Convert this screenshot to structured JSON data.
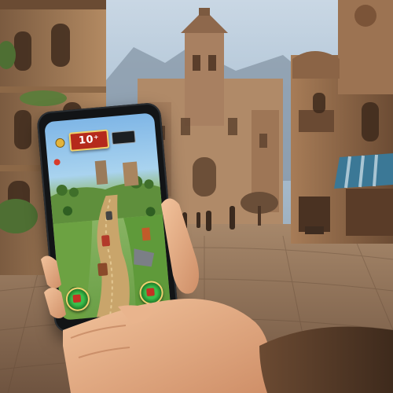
{
  "scene": {
    "description_kind": "photo-illustration",
    "colors": {
      "sky": "#b9cfe0",
      "stone": "#a07a58",
      "ground": "#8b6d52",
      "awning": "#3d7b97",
      "skin": "#e7b089"
    }
  },
  "game": {
    "score_label": "10⁺",
    "icons": {
      "coin": "coin-icon",
      "left_control": "green-round-button",
      "right_control": "green-round-button"
    }
  }
}
